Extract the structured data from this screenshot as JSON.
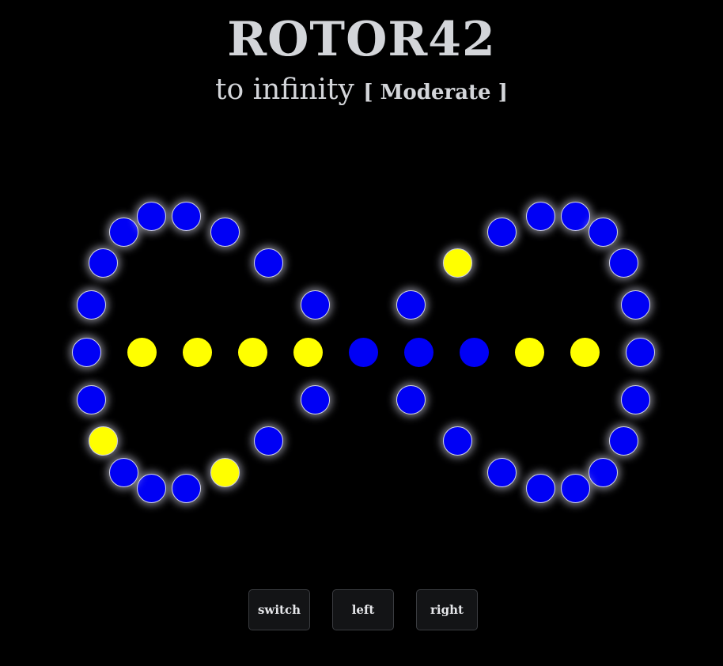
{
  "header": {
    "title": "ROTOR42",
    "subtitle": "to infinity",
    "level": "[ Moderate ]"
  },
  "colors": {
    "background": "#000000",
    "blue": "#0000f5",
    "yellow": "#ffff00",
    "text": "#d3d5d9"
  },
  "board": {
    "left_loop": [
      "blue",
      "blue",
      "blue",
      "blue",
      "blue",
      "blue",
      "blue",
      "blue",
      "blue",
      "blue",
      "blue",
      "yellow",
      "blue",
      "blue",
      "blue",
      "yellow",
      "blue",
      "blue"
    ],
    "right_loop": [
      "blue",
      "blue",
      "blue",
      "blue",
      "blue",
      "blue",
      "blue",
      "blue",
      "blue",
      "blue",
      "yellow",
      "blue",
      "blue",
      "blue",
      "blue",
      "blue",
      "blue",
      "blue"
    ],
    "center_row": [
      "yellow",
      "yellow",
      "yellow",
      "yellow",
      "blue",
      "blue",
      "blue",
      "yellow",
      "yellow"
    ]
  },
  "controls": {
    "switch_label": "switch",
    "left_label": "left",
    "right_label": "right"
  }
}
